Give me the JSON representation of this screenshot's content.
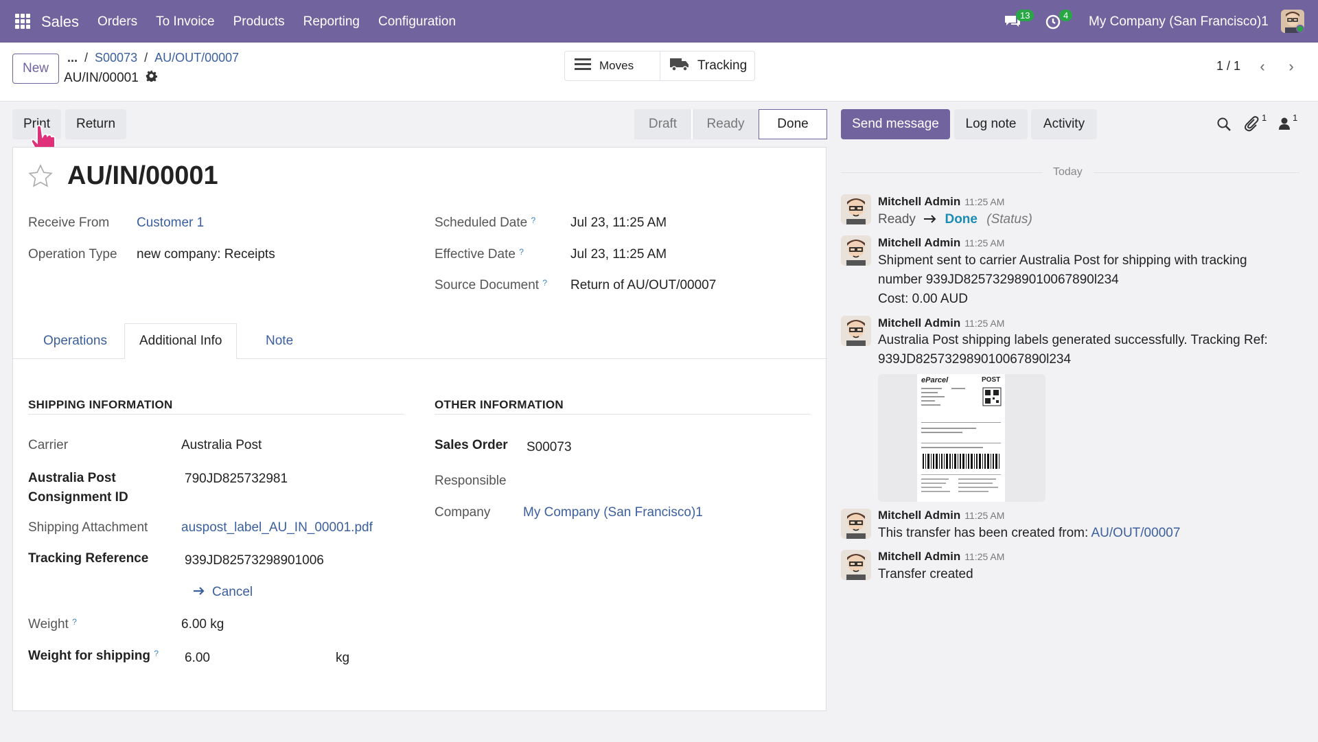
{
  "navbar": {
    "app_name": "Sales",
    "menu": [
      "Orders",
      "To Invoice",
      "Products",
      "Reporting",
      "Configuration"
    ],
    "messages_count": "13",
    "activities_count": "4",
    "company": "My Company (San Francisco)1"
  },
  "control": {
    "new_label": "New",
    "breadcrumb_more": "...",
    "breadcrumbs": [
      "S00073",
      "AU/OUT/00007"
    ],
    "record_name": "AU/IN/00001",
    "moves_label": "Moves",
    "tracking_label": "Tracking",
    "pager": "1 / 1"
  },
  "actions": {
    "print_label": "Print",
    "return_label": "Return"
  },
  "statusbar": [
    "Draft",
    "Ready",
    "Done"
  ],
  "status_active": "Done",
  "form": {
    "title": "AU/IN/00001",
    "receive_from_label": "Receive From",
    "receive_from": "Customer 1",
    "operation_type_label": "Operation Type",
    "operation_type": "new company: Receipts",
    "scheduled_date_label": "Scheduled Date",
    "scheduled_date": "Jul 23, 11:25 AM",
    "effective_date_label": "Effective Date",
    "effective_date": "Jul 23, 11:25 AM",
    "source_document_label": "Source Document",
    "source_document": "Return of AU/OUT/00007",
    "help_mark": "?",
    "tabs": [
      "Operations",
      "Additional Info",
      "Note"
    ],
    "shipping": {
      "title": "SHIPPING INFORMATION",
      "carrier_label": "Carrier",
      "carrier": "Australia Post",
      "consignment_label_1": "Australia Post",
      "consignment_label_2": "Consignment ID",
      "consignment": "790JD825732981",
      "attachment_label": "Shipping Attachment",
      "attachment": "auspost_label_AU_IN_00001.pdf",
      "tracking_label": "Tracking Reference",
      "tracking": "939JD82573298901006",
      "cancel_label": "Cancel",
      "weight_label": "Weight",
      "weight": "6.00 kg",
      "weight_shipping_label": "Weight for shipping",
      "weight_shipping": "6.00",
      "weight_unit": "kg"
    },
    "other": {
      "title": "OTHER INFORMATION",
      "sales_order_label": "Sales Order",
      "sales_order": "S00073",
      "responsible_label": "Responsible",
      "company_label": "Company",
      "company": "My Company (San Francisco)1"
    }
  },
  "chatter": {
    "send_message": "Send message",
    "log_note": "Log note",
    "activity": "Activity",
    "attachments_count": "1",
    "followers_count": "1",
    "today": "Today",
    "messages": [
      {
        "author": "Mitchell Admin",
        "time": "11:25 AM",
        "from": "Ready",
        "to": "Done",
        "field": "(Status)"
      },
      {
        "author": "Mitchell Admin",
        "time": "11:25 AM",
        "line1": "Shipment sent to carrier Australia Post for shipping with tracking",
        "line2": "number 939JD825732989010067890l234",
        "line3": "Cost: 0.00 AUD"
      },
      {
        "author": "Mitchell Admin",
        "time": "11:25 AM",
        "line1": "Australia Post shipping labels generated successfully. Tracking Ref:",
        "line2": "939JD825732989010067890l234",
        "thumb_brand": "eParcel",
        "thumb_brand2": "POST"
      },
      {
        "author": "Mitchell Admin",
        "time": "11:25 AM",
        "text": "This transfer has been created from:",
        "link": "AU/OUT/00007"
      },
      {
        "author": "Mitchell Admin",
        "time": "11:25 AM",
        "text": "Transfer created"
      }
    ]
  },
  "colors": {
    "brand": "#71639e",
    "link": "#3b5f9e",
    "badge": "#28a745",
    "status_done_link": "#1b8bb3"
  }
}
